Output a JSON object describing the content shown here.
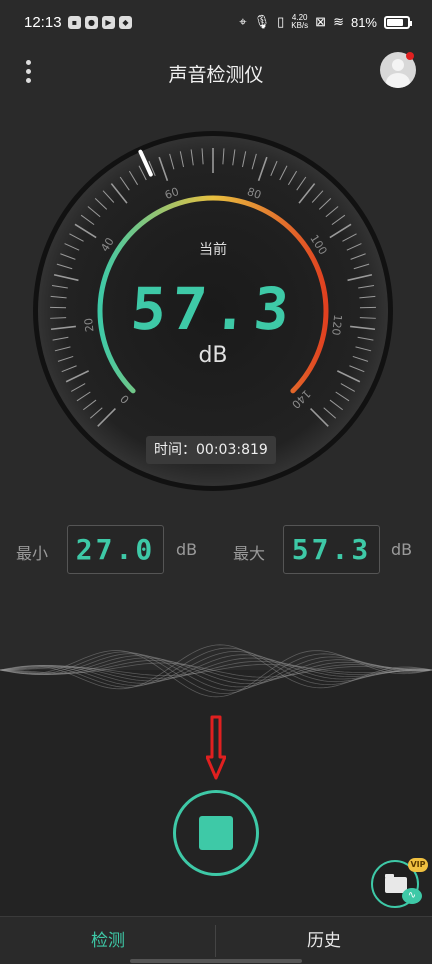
{
  "status_bar": {
    "time": "12:13",
    "speed_top": "4.20",
    "speed_bottom": "KB/s",
    "battery": "81%",
    "battery_level": 0.81
  },
  "header": {
    "title": "声音检测仪"
  },
  "gauge": {
    "current_label": "当前",
    "value": "57.3",
    "unit": "dB",
    "time_label": "时间：",
    "time_value": "00:03:819",
    "scale_ticks": [
      "0",
      "20",
      "40",
      "60",
      "80",
      "100",
      "120",
      "140"
    ],
    "needle_value": 57.3,
    "range": [
      0,
      140
    ],
    "accent": "#3ec9a7",
    "gradient": [
      "#3ec9a7",
      "#e8c040",
      "#e04020"
    ]
  },
  "stats": {
    "min_label": "最小",
    "min_value": "27.0",
    "min_unit": "dB",
    "max_label": "最大",
    "max_value": "57.3",
    "max_unit": "dB"
  },
  "controls": {
    "vip": "VIP"
  },
  "nav": {
    "detect": "检测",
    "history": "历史"
  },
  "colors": {
    "accent": "#3ec9a7",
    "arrow": "#e02020",
    "background": "#2a2a2a"
  }
}
